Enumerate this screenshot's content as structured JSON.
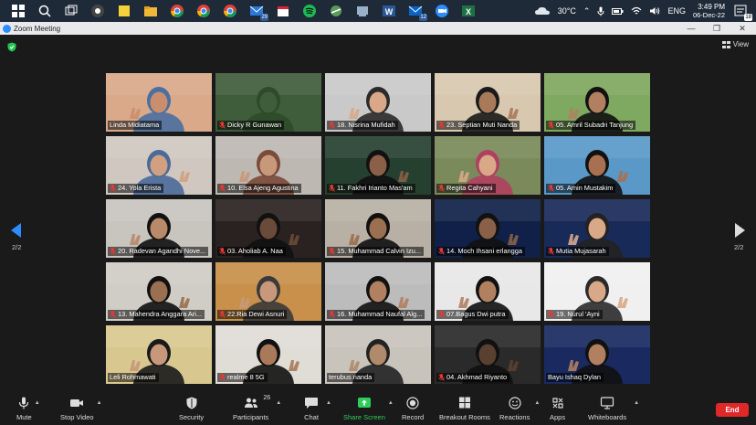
{
  "taskbar": {
    "weather": "30°C",
    "lang": "ENG",
    "time": "3:49 PM",
    "date": "06-Dec-22",
    "badges": {
      "mail": "29",
      "outlook": "12",
      "notif": "18"
    }
  },
  "window": {
    "title": "Zoom Meeting"
  },
  "meeting": {
    "view_label": "View",
    "page_left": "2/2",
    "page_right": "2/2",
    "participants": [
      {
        "name": "Linda Midiatama",
        "muted": false,
        "active": true,
        "bg": "#d9a98a",
        "skin": "#c98e6e",
        "hair": "#4a6fa0"
      },
      {
        "name": "Dicky R Gunawan",
        "muted": true,
        "active": false,
        "bg": "#3f5d3a",
        "skin": "#3f5d3a",
        "hair": "#2e4a2a"
      },
      {
        "name": "18. Nisrina Mufidah",
        "muted": true,
        "active": false,
        "bg": "#c9c9c9",
        "skin": "#d8a888",
        "hair": "#2a2a2a"
      },
      {
        "name": "23. Septian Muti Nanda",
        "muted": true,
        "active": false,
        "bg": "#d8c8b0",
        "skin": "#a87a5a",
        "hair": "#1a1a1a"
      },
      {
        "name": "05. Amril Subadri Tanjung",
        "muted": true,
        "active": false,
        "bg": "#7fa860",
        "skin": "#b08060",
        "hair": "#111"
      },
      {
        "name": "24. Yola Erista",
        "muted": true,
        "active": false,
        "bg": "#d0c8c0",
        "skin": "#d0a080",
        "hair": "#4a6a9a"
      },
      {
        "name": "10. Elsa Ajeng Agustina",
        "muted": true,
        "active": false,
        "bg": "#bdb8b2",
        "skin": "#c8987a",
        "hair": "#7a4a3a"
      },
      {
        "name": "11. Fakhri Irianto Mas'am",
        "muted": true,
        "active": false,
        "bg": "#264030",
        "skin": "#8a6048",
        "hair": "#111"
      },
      {
        "name": "Regita Cahyani",
        "muted": true,
        "active": false,
        "bg": "#7a8a5a",
        "skin": "#d8a888",
        "hair": "#b04060"
      },
      {
        "name": "05. Amin Mustakim",
        "muted": true,
        "active": false,
        "bg": "#5a98c8",
        "skin": "#a87050",
        "hair": "#111"
      },
      {
        "name": "20. Radevan Agandhi Nove...",
        "muted": true,
        "active": false,
        "bg": "#c8c4be",
        "skin": "#b88a6a",
        "hair": "#111"
      },
      {
        "name": "03. Aholiab A. Naa",
        "muted": true,
        "active": false,
        "bg": "#2a2220",
        "skin": "#6a4a38",
        "hair": "#111"
      },
      {
        "name": "15. Muhammad Calvin Izu...",
        "muted": true,
        "active": false,
        "bg": "#b8b0a4",
        "skin": "#9a7050",
        "hair": "#111"
      },
      {
        "name": "14. Moch Ihsani erlangga",
        "muted": true,
        "active": false,
        "bg": "#102048",
        "skin": "#8a6048",
        "hair": "#111"
      },
      {
        "name": "Mutia Mujasarah",
        "muted": true,
        "active": false,
        "bg": "#182a58",
        "skin": "#d8a888",
        "hair": "#222"
      },
      {
        "name": "13. Mahendra Anggara Ari...",
        "muted": true,
        "active": false,
        "bg": "#d0ccc6",
        "skin": "#9a7050",
        "hair": "#111"
      },
      {
        "name": "22.Ria Dewi Asnuri",
        "muted": true,
        "active": false,
        "bg": "#c8904a",
        "skin": "#c8987a",
        "hair": "#3a3a3a"
      },
      {
        "name": "16. Muhammad Naufal Alg...",
        "muted": true,
        "active": false,
        "bg": "#bcbcbc",
        "skin": "#b08060",
        "hair": "#111"
      },
      {
        "name": "07.Bagus Dwi putra",
        "muted": true,
        "active": false,
        "bg": "#e8e8e8",
        "skin": "#b08060",
        "hair": "#111"
      },
      {
        "name": "19. Nurul 'Ayni",
        "muted": true,
        "active": false,
        "bg": "#f0f0f0",
        "skin": "#d8a888",
        "hair": "#2a2a2a"
      },
      {
        "name": "Leli Rohmawati",
        "muted": false,
        "active": false,
        "bg": "#d8c890",
        "skin": "#c8987a",
        "hair": "#1a1a1a"
      },
      {
        "name": "realme 8 5G",
        "muted": true,
        "active": false,
        "bg": "#e0dcd6",
        "skin": "#a87a5a",
        "hair": "#111"
      },
      {
        "name": "terubus nanda",
        "muted": false,
        "active": false,
        "bg": "#c8c4bc",
        "skin": "#b08a6a",
        "hair": "#222"
      },
      {
        "name": "04. Akhmad Riyanto",
        "muted": true,
        "active": false,
        "bg": "#2a2a2a",
        "skin": "#5a4030",
        "hair": "#111"
      },
      {
        "name": "Bayu Ishaq Dylan",
        "muted": false,
        "active": false,
        "bg": "#1a2a60",
        "skin": "#b08060",
        "hair": "#111"
      }
    ]
  },
  "controls": {
    "mute": "Mute",
    "stop_video": "Stop Video",
    "security": "Security",
    "participants": "Participants",
    "participant_count": "26",
    "chat": "Chat",
    "share_screen": "Share Screen",
    "record": "Record",
    "breakout_rooms": "Breakout Rooms",
    "reactions": "Reactions",
    "apps": "Apps",
    "whiteboards": "Whiteboards",
    "end": "End"
  },
  "colors": {
    "accent_share": "#2ecc5b",
    "end": "#e02828",
    "active_speaker": "#c8e052",
    "zoom_blue": "#2d8cff"
  }
}
